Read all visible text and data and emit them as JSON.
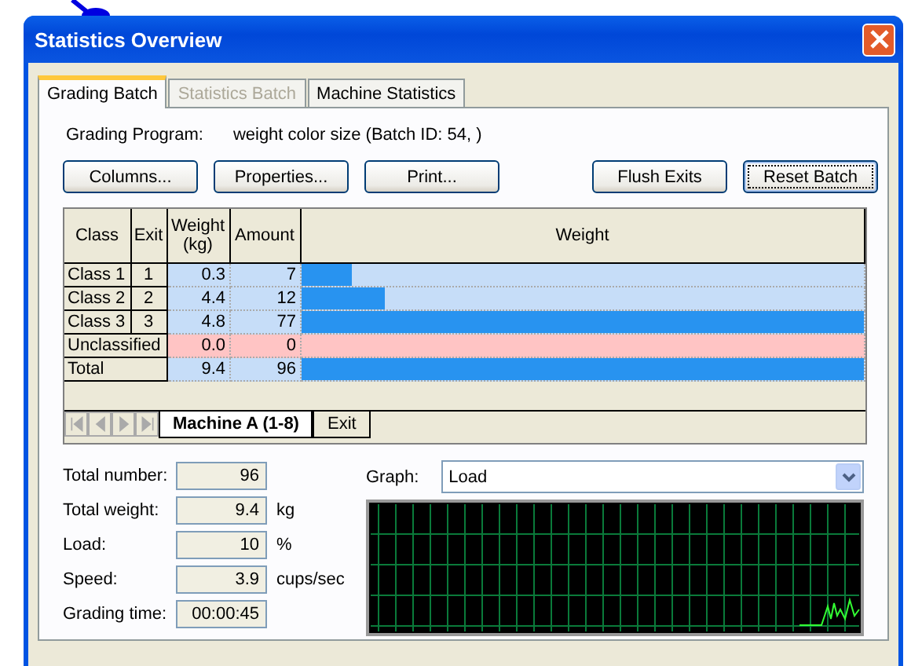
{
  "window": {
    "title": "Statistics Overview"
  },
  "tabs": [
    {
      "label": "Grading Batch",
      "selected": true,
      "disabled": false
    },
    {
      "label": "Statistics Batch",
      "selected": false,
      "disabled": true
    },
    {
      "label": "Machine Statistics",
      "selected": false,
      "disabled": false
    }
  ],
  "grading_program": {
    "label": "Grading Program:",
    "value": "weight color size (Batch ID: 54, )"
  },
  "buttons_left": [
    {
      "label": "Columns...",
      "focused": false
    },
    {
      "label": "Properties...",
      "focused": false
    },
    {
      "label": "Print...",
      "focused": false
    }
  ],
  "buttons_right": [
    {
      "label": "Flush Exits",
      "focused": false
    },
    {
      "label": "Reset Batch",
      "focused": true
    }
  ],
  "table": {
    "columns": [
      "Class",
      "Exit",
      "Weight (kg)",
      "Amount",
      "Weight"
    ],
    "rows": [
      {
        "kind": "class",
        "class": "Class 1",
        "exit": "1",
        "weight": "0.3",
        "amount": "7",
        "level": 0.09
      },
      {
        "kind": "class",
        "class": "Class 2",
        "exit": "2",
        "weight": "4.4",
        "amount": "12",
        "level": 0.15
      },
      {
        "kind": "class",
        "class": "Class 3",
        "exit": "3",
        "weight": "4.8",
        "amount": "77",
        "level": 1
      },
      {
        "kind": "unclassified",
        "class": "Unclassified",
        "weight": "0.0",
        "amount": "0",
        "level": 0
      },
      {
        "kind": "total",
        "class": "Total",
        "weight": "9.4",
        "amount": "96",
        "level": 1
      }
    ]
  },
  "sheet_tabs": [
    {
      "label": "Machine A (1-8)",
      "selected": true
    },
    {
      "label": "Exit",
      "selected": false
    }
  ],
  "stats": [
    {
      "label": "Total number:",
      "value": "96"
    },
    {
      "label": "Total weight:",
      "value": "9.4",
      "unit": "kg"
    },
    {
      "label": "Load:",
      "value": "10",
      "unit": "%"
    },
    {
      "label": "Speed:",
      "value": "3.9",
      "unit": "cups/sec"
    },
    {
      "label": "Grading time:",
      "value": "00:00:45"
    }
  ],
  "graph": {
    "label": "Graph:",
    "value": "Load"
  }
}
